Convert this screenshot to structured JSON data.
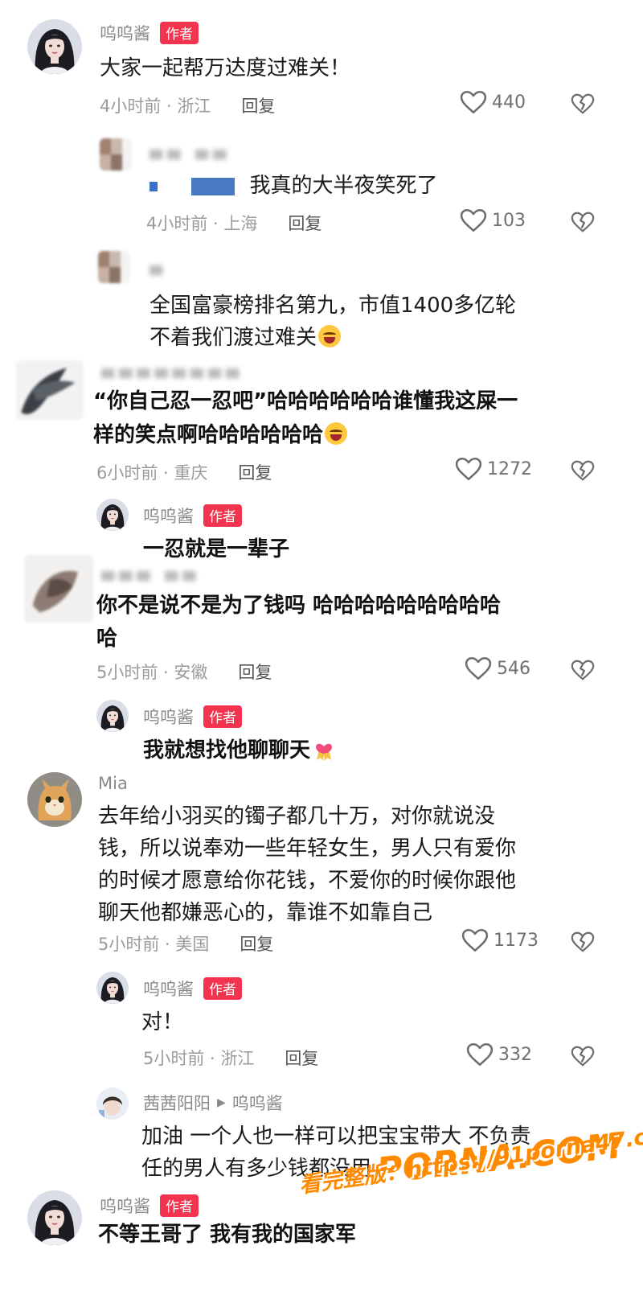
{
  "comments": [
    {
      "name": "呜呜酱",
      "tag": "作者",
      "text": "大家一起帮万达度过难关！",
      "time": "4小时前 · 浙江",
      "reply": "回复",
      "likes": "440"
    },
    {
      "name": "",
      "text": "我真的大半夜笑死了",
      "time": "4小时前 · 上海",
      "reply": "回复",
      "likes": "103"
    },
    {
      "name": "",
      "lines": [
        "全国富豪榜排名第九，市值1400多亿轮",
        "不着我们渡过难关"
      ]
    },
    {
      "name": "",
      "lines": [
        "“你自己忍一忍吧”哈哈哈哈哈哈谁懂我这屎一",
        "样的笑点啊哈哈哈哈哈哈"
      ],
      "time": "6小时前 · 重庆",
      "reply": "回复",
      "likes": "1272"
    },
    {
      "name": "呜呜酱",
      "tag": "作者",
      "text": "一忍就是一辈子"
    },
    {
      "name": "",
      "lines": [
        "你不是说不是为了钱吗 哈哈哈哈哈哈哈哈哈",
        "哈"
      ],
      "time": "5小时前 · 安徽",
      "reply": "回复",
      "likes": "546"
    },
    {
      "name": "呜呜酱",
      "tag": "作者",
      "text": "我就想找他聊聊天"
    },
    {
      "name": "Mia",
      "lines": [
        "去年给小羽买的镯子都几十万，对你就说没",
        "钱，所以说奉劝一些年轻女生，男人只有爱你",
        "的时候才愿意给你花钱，不爱你的时候你跟他",
        "聊天他都嫌恶心的，靠谁不如靠自己"
      ],
      "time": "5小时前 · 美国",
      "reply": "回复",
      "likes": "1173"
    },
    {
      "name": "呜呜酱",
      "tag": "作者",
      "text": "对！",
      "time": "5小时前 · 浙江",
      "reply": "回复",
      "likes": "332"
    },
    {
      "name": "茜茜阳阳",
      "reply_to": "呜呜酱",
      "lines": [
        "加油 一个人也一样可以把宝宝带大 不负责",
        "任的男人有多少钱都没用"
      ]
    },
    {
      "name": "呜呜酱",
      "tag": "作者",
      "text": "不等王哥了 我有我的国家军"
    }
  ],
  "watermark": {
    "logo": "PORNA.COM",
    "url": "看完整版：https://91porna47.com"
  },
  "colors": {
    "author_tag": "#f2344f",
    "meta": "#9b9b9b",
    "watermark": "#ff8a00"
  }
}
